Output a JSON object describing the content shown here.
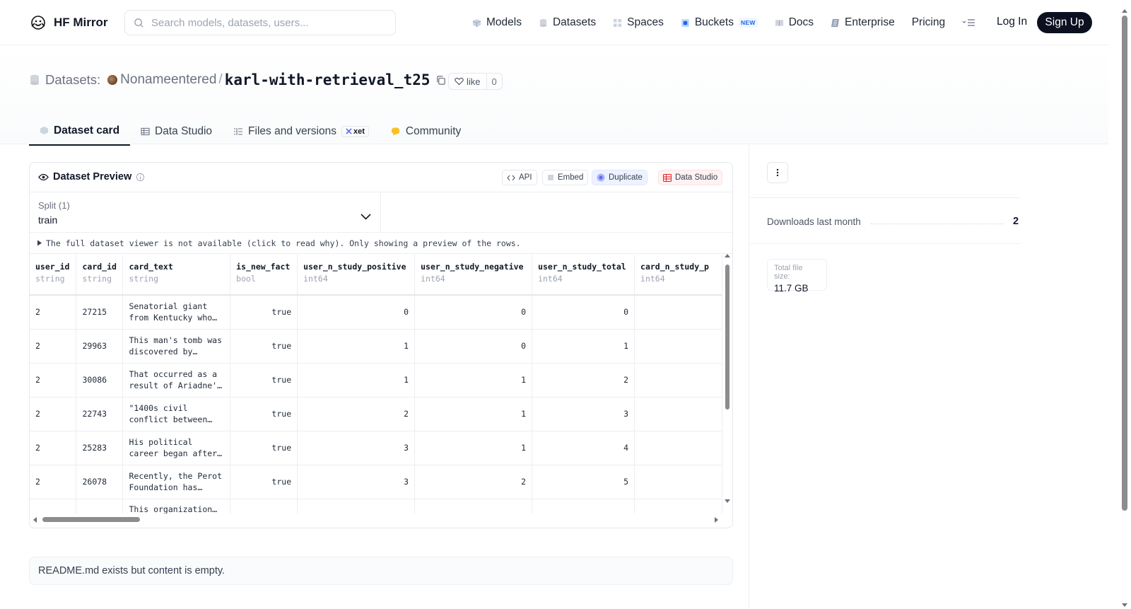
{
  "header": {
    "brand": "HF Mirror",
    "search_placeholder": "Search models, datasets, users...",
    "nav": [
      {
        "label": "Models",
        "icon": "models-icon"
      },
      {
        "label": "Datasets",
        "icon": "datasets-icon"
      },
      {
        "label": "Spaces",
        "icon": "spaces-icon"
      },
      {
        "label": "Buckets",
        "icon": "buckets-icon",
        "badge": "NEW"
      },
      {
        "label": "Docs",
        "icon": "docs-icon"
      },
      {
        "label": "Enterprise",
        "icon": "enterprise-icon"
      },
      {
        "label": "Pricing"
      }
    ],
    "login": "Log In",
    "signup": "Sign Up"
  },
  "repo": {
    "type_label": "Datasets:",
    "owner": "Nonameentered",
    "slash": "/",
    "name": "karl-with-retrieval_t25",
    "like_label": "like",
    "like_count": "0"
  },
  "tabs": [
    {
      "label": "Dataset card",
      "active": true
    },
    {
      "label": "Data Studio"
    },
    {
      "label": "Files and versions",
      "badge": "xet"
    },
    {
      "label": "Community"
    }
  ],
  "preview": {
    "title": "Dataset Preview",
    "actions": {
      "api": "API",
      "embed": "Embed",
      "duplicate": "Duplicate",
      "data_studio": "Data Studio"
    },
    "split_label": "Split (1)",
    "split_value": "train",
    "notice": "The full dataset viewer is not available (click to read why). Only showing a preview of the rows.",
    "columns": [
      {
        "name": "user_id",
        "type": "string"
      },
      {
        "name": "card_id",
        "type": "string"
      },
      {
        "name": "card_text",
        "type": "string"
      },
      {
        "name": "is_new_fact",
        "type": "bool"
      },
      {
        "name": "user_n_study_positive",
        "type": "int64"
      },
      {
        "name": "user_n_study_negative",
        "type": "int64"
      },
      {
        "name": "user_n_study_total",
        "type": "int64"
      },
      {
        "name": "card_n_study_p",
        "type": "int64"
      }
    ],
    "rows": [
      [
        "2",
        "27215",
        "Senatorial giant from Kentucky who…",
        "true",
        "0",
        "0",
        "0",
        ""
      ],
      [
        "2",
        "29963",
        "This man's tomb was discovered by…",
        "true",
        "1",
        "0",
        "1",
        ""
      ],
      [
        "2",
        "30086",
        "That occurred as a result of Ariadne'…",
        "true",
        "1",
        "1",
        "2",
        ""
      ],
      [
        "2",
        "22743",
        "\"1400s civil conflict between…",
        "true",
        "2",
        "1",
        "3",
        ""
      ],
      [
        "2",
        "25283",
        "His political career began after…",
        "true",
        "3",
        "1",
        "4",
        ""
      ],
      [
        "2",
        "26078",
        "Recently, the Perot Foundation has…",
        "true",
        "3",
        "2",
        "5",
        ""
      ],
      [
        "",
        "",
        "This organization…",
        "",
        "",
        "",
        "",
        ""
      ]
    ]
  },
  "readme": "README.md exists but content is empty.",
  "sidebar": {
    "downloads_label": "Downloads last month",
    "downloads_value": "2",
    "size_label": "Total file size:",
    "size_value": "11.7 GB"
  }
}
